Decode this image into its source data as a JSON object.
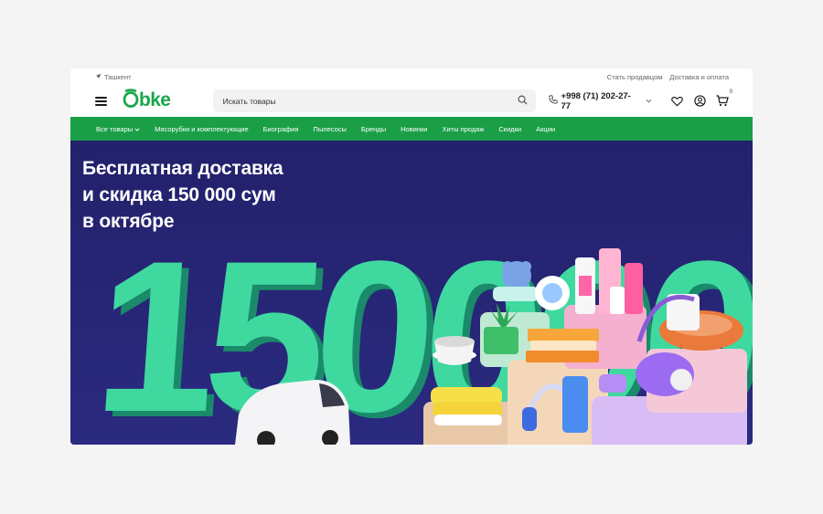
{
  "topbar": {
    "city": "Ташкент",
    "link_seller": "Стать продавцом",
    "link_delivery": "Доставка и оплата"
  },
  "header": {
    "logo_text": "Obke",
    "search_placeholder": "Искать товары",
    "phone": "+998 (71) 202-27-77",
    "cart_count": "0"
  },
  "nav": {
    "items": [
      {
        "label": "Все товары"
      },
      {
        "label": "Мясорубки и комплектующие"
      },
      {
        "label": "Биография"
      },
      {
        "label": "Пылесосы"
      },
      {
        "label": "Бренды"
      },
      {
        "label": "Новинки"
      },
      {
        "label": "Хиты продаж"
      },
      {
        "label": "Скидки"
      },
      {
        "label": "Акции"
      }
    ]
  },
  "banner": {
    "line1": "Бесплатная доставка",
    "line2": "и скидка 150 000 сум",
    "line3": "в октябре",
    "big_number": "150000"
  },
  "colors": {
    "brand_green": "#19a74a",
    "nav_green": "#1a9f46",
    "banner_bg": "#24236a",
    "number_mint": "#3fd9a0"
  }
}
